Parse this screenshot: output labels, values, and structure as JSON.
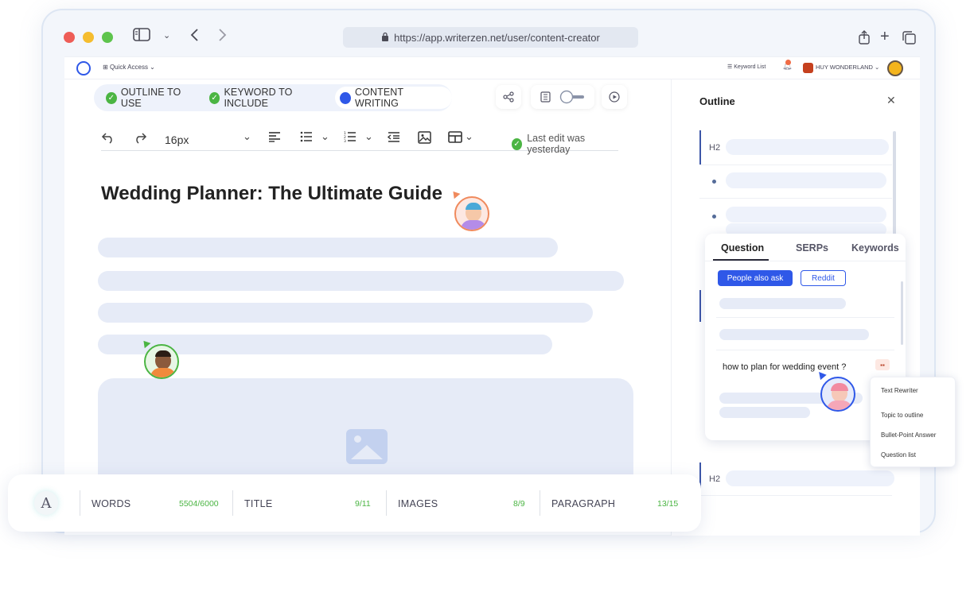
{
  "browser": {
    "url": "https://app.writerzen.net/user/content-creator"
  },
  "appbar": {
    "quick_access": "Quick Access",
    "keyword_list": "Keyword List",
    "user_name": "HUY WONDERLAND"
  },
  "steps": [
    {
      "label": "OUTLINE TO USE",
      "state": "done"
    },
    {
      "label": "KEYWORD TO INCLUDE",
      "state": "done"
    },
    {
      "label": "CONTENT WRITING",
      "state": "active"
    }
  ],
  "toolbar": {
    "font_size": "16px",
    "last_edit": "Last edit was yesterday"
  },
  "document": {
    "title": "Wedding Planner: The Ultimate Guide"
  },
  "outline": {
    "title": "Outline",
    "h2_label": "H2",
    "h2_label_bottom": "H2"
  },
  "question_card": {
    "tabs": [
      "Question",
      "SERPs",
      "Keywords"
    ],
    "chips": [
      "People also ask",
      "Reddit"
    ],
    "question": "how to plan for wedding event ?"
  },
  "context_menu": {
    "items": [
      "Text Rewriter",
      "Topic to outline",
      "Bullet-Point Answer",
      "Question list"
    ]
  },
  "stats": {
    "words": {
      "label": "WORDS",
      "value": "5504/6000"
    },
    "title": {
      "label": "TITLE",
      "value": "9/11"
    },
    "images": {
      "label": "IMAGES",
      "value": "8/9"
    },
    "paragraph": {
      "label": "PARAGRAPH",
      "value": "13/15"
    },
    "logo": "A"
  },
  "colors": {
    "accent": "#2f58e8",
    "success": "#4bb543",
    "skeleton": "#e6ebf7"
  }
}
